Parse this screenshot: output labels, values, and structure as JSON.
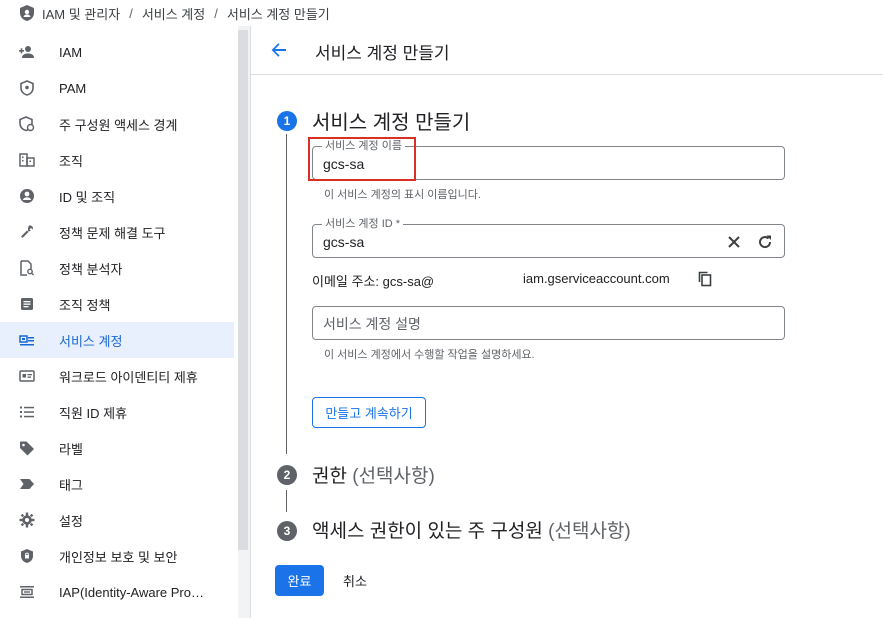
{
  "breadcrumb": {
    "items": [
      "IAM 및 관리자",
      "서비스 계정",
      "서비스 계정 만들기"
    ],
    "separator": "/"
  },
  "sidebar": {
    "items": [
      {
        "label": "IAM",
        "icon": "person-add-icon"
      },
      {
        "label": "PAM",
        "icon": "shield-icon"
      },
      {
        "label": "주 구성원 액세스 경계",
        "icon": "shield-person-icon"
      },
      {
        "label": "조직",
        "icon": "building-icon"
      },
      {
        "label": "ID 및 조직",
        "icon": "account-circle-icon"
      },
      {
        "label": "정책 문제 해결 도구",
        "icon": "wrench-icon"
      },
      {
        "label": "정책 분석자",
        "icon": "document-search-icon"
      },
      {
        "label": "조직 정책",
        "icon": "list-document-icon"
      },
      {
        "label": "서비스 계정",
        "icon": "service-account-icon",
        "active": true
      },
      {
        "label": "워크로드 아이덴티티 제휴",
        "icon": "id-card-icon"
      },
      {
        "label": "직원 ID 제휴",
        "icon": "list-icon"
      },
      {
        "label": "라벨",
        "icon": "tag-icon"
      },
      {
        "label": "태그",
        "icon": "label-arrow-icon"
      },
      {
        "label": "설정",
        "icon": "gear-icon"
      },
      {
        "label": "개인정보 보호 및 보안",
        "icon": "shield-lock-icon"
      },
      {
        "label": "IAP(Identity-Aware Pro…",
        "icon": "iap-icon"
      }
    ]
  },
  "header": {
    "title": "서비스 계정 만들기"
  },
  "steps": [
    {
      "number": "1",
      "title": "서비스 계정 만들기",
      "optional": ""
    },
    {
      "number": "2",
      "title": "권한 ",
      "optional": "(선택사항)"
    },
    {
      "number": "3",
      "title": "액세스 권한이 있는 주 구성원 ",
      "optional": "(선택사항)"
    }
  ],
  "form": {
    "name_label": "서비스 계정 이름",
    "name_value": "gcs-sa",
    "name_hint": "이 서비스 계정의 표시 이름입니다.",
    "id_label": "서비스 계정 ID *",
    "id_value": "gcs-sa",
    "email_prefix": "이메일 주소: gcs-sa@",
    "email_domain": "iam.gserviceaccount.com",
    "desc_placeholder": "서비스 계정 설명",
    "desc_hint": "이 서비스 계정에서 수행할 작업을 설명하세요.",
    "continue_label": "만들고 계속하기"
  },
  "footer": {
    "done_label": "완료",
    "cancel_label": "취소"
  },
  "colors": {
    "accent": "#1a73e8",
    "active_bg": "#e8f0fe",
    "highlight": "#d93025"
  }
}
